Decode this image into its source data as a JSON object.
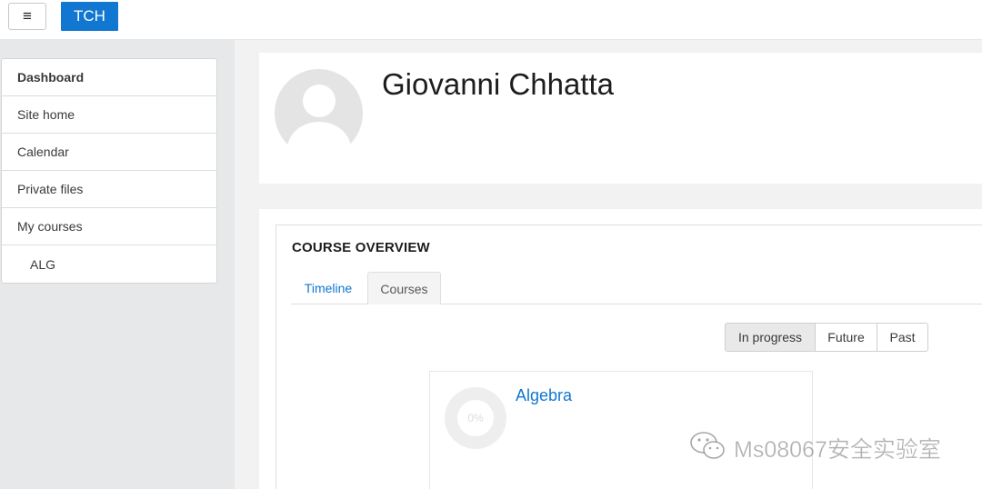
{
  "navbar": {
    "menu_icon": "hamburger-icon",
    "menu_glyph": "≡",
    "brand": "TCH"
  },
  "sidebar": {
    "items": [
      {
        "label": "Dashboard"
      },
      {
        "label": "Site home"
      },
      {
        "label": "Calendar"
      },
      {
        "label": "Private files"
      },
      {
        "label": "My courses"
      },
      {
        "label": "ALG"
      }
    ]
  },
  "header": {
    "user_name": "Giovanni Chhatta",
    "avatar_icon": "user-avatar-icon"
  },
  "course_overview": {
    "title": "COURSE OVERVIEW",
    "tabs": [
      {
        "label": "Timeline"
      },
      {
        "label": "Courses"
      }
    ],
    "filters": [
      {
        "label": "In progress"
      },
      {
        "label": "Future"
      },
      {
        "label": "Past"
      }
    ],
    "course": {
      "name": "Algebra",
      "progress_label": "0%",
      "progress": 0
    }
  },
  "watermark": {
    "text": "Ms08067安全实验室",
    "icon": "wechat-icon"
  },
  "colors": {
    "accent": "#1177d1",
    "sidebar_bg": "#e7e8ea",
    "page_bg": "#f2f2f2"
  }
}
